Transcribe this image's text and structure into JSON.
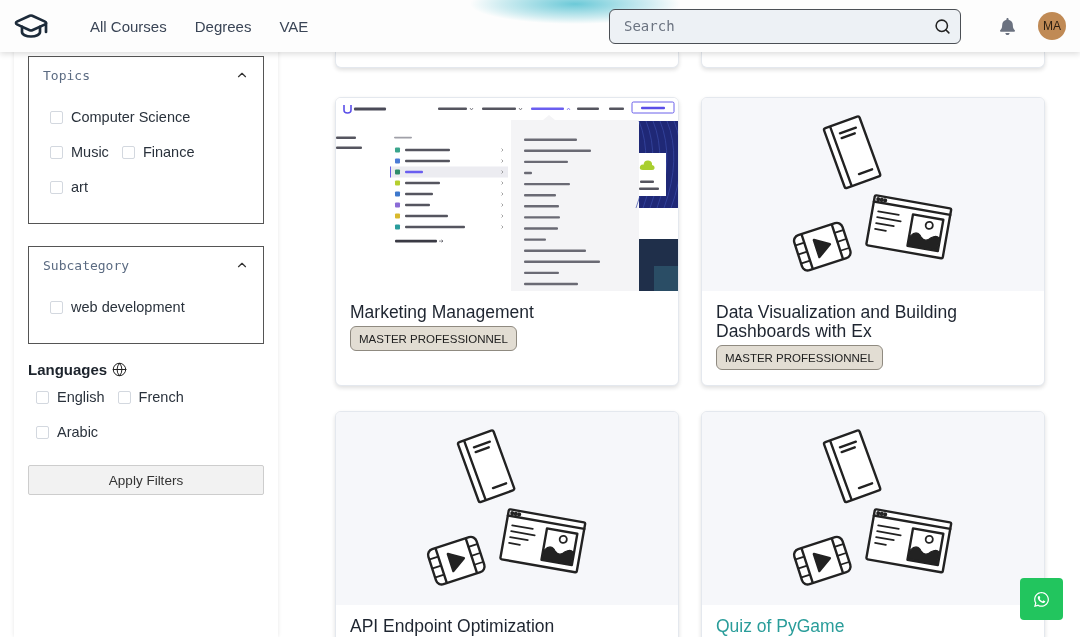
{
  "header": {
    "nav": [
      {
        "label": "All Courses"
      },
      {
        "label": "Degrees"
      },
      {
        "label": "VAE"
      }
    ],
    "search": {
      "placeholder": "Search"
    },
    "avatar": {
      "initials": "MA"
    }
  },
  "filters": {
    "panels": [
      {
        "title": "Topics",
        "expanded": true,
        "options": [
          {
            "label": "Computer Science",
            "checked": false
          },
          {
            "label": "Music",
            "checked": false
          },
          {
            "label": "Finance",
            "checked": false
          },
          {
            "label": "art",
            "checked": false
          }
        ]
      },
      {
        "title": "Subcategory",
        "expanded": true,
        "options": [
          {
            "label": "web development",
            "checked": false
          }
        ]
      }
    ],
    "languages": {
      "title": "Languages",
      "options": [
        {
          "label": "English",
          "checked": false
        },
        {
          "label": "French",
          "checked": false
        },
        {
          "label": "Arabic",
          "checked": false
        }
      ]
    },
    "apply_button": {
      "label": "Apply Filters"
    }
  },
  "cards": [
    {
      "kind": "cut_off"
    },
    {
      "kind": "cut_off"
    },
    {
      "kind": "full",
      "hovered": false,
      "title": "Marketing Management",
      "badge": "MASTER PROFESSIONNEL",
      "image": {
        "kind": "screenshot"
      }
    },
    {
      "kind": "full",
      "hovered": false,
      "title": "Data Visualization and Building Dashboards with Ex",
      "badge": "MASTER PROFESSIONNEL",
      "image": {
        "kind": "illustration"
      }
    },
    {
      "kind": "full",
      "hovered": false,
      "title": "API Endpoint Optimization",
      "image": {
        "kind": "illustration"
      }
    },
    {
      "kind": "full",
      "hovered": true,
      "title": "Quiz of PyGame",
      "image": {
        "kind": "illustration"
      }
    }
  ]
}
